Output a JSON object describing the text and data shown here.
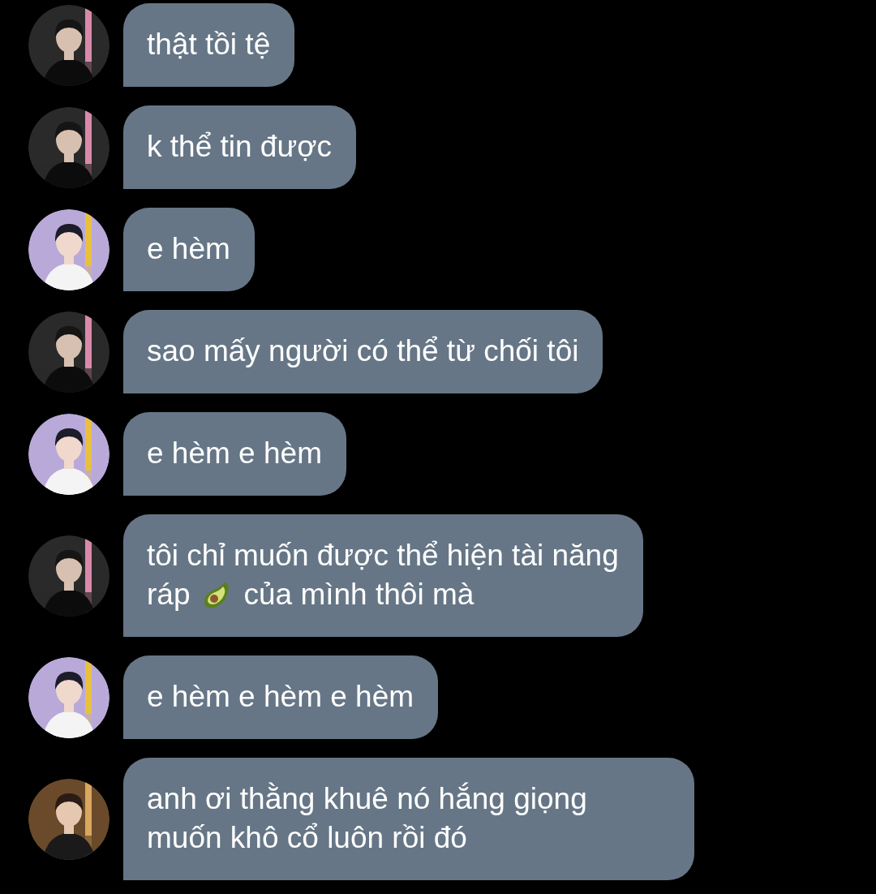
{
  "messages": [
    {
      "avatar": {
        "kind": "picture"
      },
      "lines": [
        [
          {
            "kind": "text",
            "text": "thật tồi tệ"
          }
        ]
      ]
    },
    {
      "avatar": {
        "kind": "picture"
      },
      "lines": [
        [
          {
            "kind": "text",
            "text": "k thể tin được"
          }
        ]
      ]
    },
    {
      "avatar": {
        "kind": "picture"
      },
      "lines": [
        [
          {
            "kind": "text",
            "text": "e hèm"
          }
        ]
      ]
    },
    {
      "avatar": {
        "kind": "picture"
      },
      "lines": [
        [
          {
            "kind": "text",
            "text": "sao mấy người có thể từ chối tôi"
          }
        ]
      ]
    },
    {
      "avatar": {
        "kind": "picture"
      },
      "lines": [
        [
          {
            "kind": "text",
            "text": "e hèm e hèm"
          }
        ]
      ]
    },
    {
      "avatar": {
        "kind": "picture"
      },
      "lines": [
        [
          {
            "kind": "text",
            "text": "tôi chỉ muốn được thể hiện tài năng"
          }
        ],
        [
          {
            "kind": "text",
            "text": "ráp"
          },
          {
            "kind": "emoji"
          },
          {
            "kind": "text",
            "text": "của mình thôi mà"
          }
        ]
      ]
    },
    {
      "avatar": {
        "kind": "picture"
      },
      "lines": [
        [
          {
            "kind": "text",
            "text": "e hèm e hèm e hèm"
          }
        ]
      ]
    },
    {
      "avatar": {
        "kind": "picture"
      },
      "lines": [
        [
          {
            "kind": "text",
            "text": "anh ơi thằng khuê nó hắng giọng muốn khô cổ luôn rồi đó"
          }
        ]
      ]
    }
  ]
}
